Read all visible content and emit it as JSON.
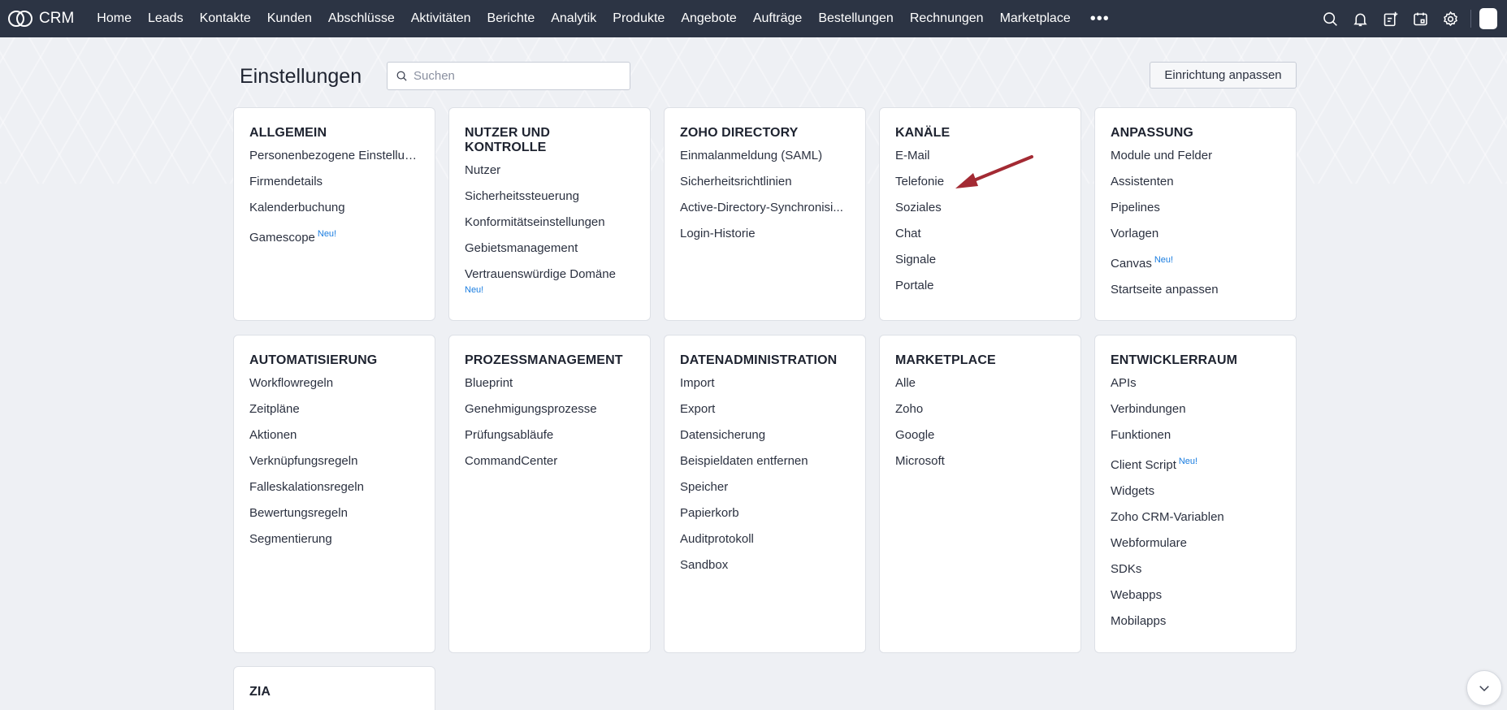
{
  "topbar": {
    "app_name": "CRM",
    "nav": [
      "Home",
      "Leads",
      "Kontakte",
      "Kunden",
      "Abschlüsse",
      "Aktivitäten",
      "Berichte",
      "Analytik",
      "Produkte",
      "Angebote",
      "Aufträge",
      "Bestellungen",
      "Rechnungen",
      "Marketplace"
    ],
    "more": "•••",
    "icons": [
      "search-icon",
      "bell-icon",
      "add-note-icon",
      "calendar-icon",
      "gear-icon"
    ]
  },
  "header": {
    "title": "Einstellungen",
    "search_placeholder": "Suchen",
    "customize_label": "Einrichtung anpassen"
  },
  "badge_new": "Neu!",
  "cards": {
    "allgemein": {
      "title": "ALLGEMEIN",
      "items": [
        "Personenbezogene Einstellun...",
        "Firmendetails",
        "Kalenderbuchung",
        "Gamescope"
      ]
    },
    "nutzer": {
      "title": "NUTZER UND KONTROLLE",
      "items": [
        "Nutzer",
        "Sicherheitssteuerung",
        "Konformitätseinstellungen",
        "Gebietsmanagement",
        "Vertrauenswürdige Domäne"
      ]
    },
    "directory": {
      "title": "ZOHO DIRECTORY",
      "items": [
        "Einmalanmeldung (SAML)",
        "Sicherheitsrichtlinien",
        "Active-Directory-Synchronisi...",
        "Login-Historie"
      ]
    },
    "kanaele": {
      "title": "KANÄLE",
      "items": [
        "E-Mail",
        "Telefonie",
        "Soziales",
        "Chat",
        "Signale",
        "Portale"
      ]
    },
    "anpassung": {
      "title": "ANPASSUNG",
      "items": [
        "Module und Felder",
        "Assistenten",
        "Pipelines",
        "Vorlagen",
        "Canvas",
        "Startseite anpassen"
      ]
    },
    "automatisierung": {
      "title": "AUTOMATISIERUNG",
      "items": [
        "Workflowregeln",
        "Zeitpläne",
        "Aktionen",
        "Verknüpfungsregeln",
        "Falleskalationsregeln",
        "Bewertungsregeln",
        "Segmentierung"
      ]
    },
    "prozess": {
      "title": "PROZESSMANAGEMENT",
      "items": [
        "Blueprint",
        "Genehmigungsprozesse",
        "Prüfungsabläufe",
        "CommandCenter"
      ]
    },
    "daten": {
      "title": "DATENADMINISTRATION",
      "items": [
        "Import",
        "Export",
        "Datensicherung",
        "Beispieldaten entfernen",
        "Speicher",
        "Papierkorb",
        "Auditprotokoll",
        "Sandbox"
      ]
    },
    "marketplace": {
      "title": "MARKETPLACE",
      "items": [
        "Alle",
        "Zoho",
        "Google",
        "Microsoft"
      ]
    },
    "entwickler": {
      "title": "ENTWICKLERRAUM",
      "items": [
        "APIs",
        "Verbindungen",
        "Funktionen",
        "Client Script",
        "Widgets",
        "Zoho CRM-Variablen",
        "Webformulare",
        "SDKs",
        "Webapps",
        "Mobilapps"
      ]
    },
    "zia": {
      "title": "ZIA",
      "items": []
    }
  },
  "colors": {
    "topbar": "#2c3444",
    "new_badge": "#1a7de0",
    "arrow": "#a32a33"
  }
}
